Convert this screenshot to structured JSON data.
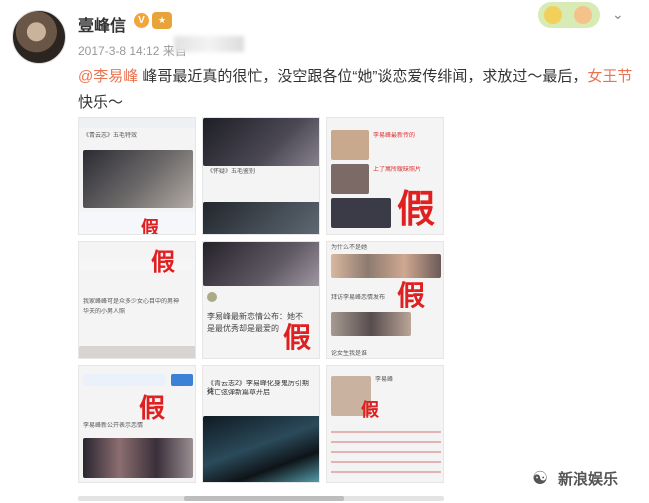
{
  "author": {
    "name": "壹峰信",
    "verified_mark": "V",
    "timestamp": "2017-3-8 14:12 来自"
  },
  "post": {
    "mention": "@李易峰",
    "text_before_tag": " 峰哥最近真的很忙，没空跟各位“她”谈恋爱传绯闻，求放过～最后，",
    "tag": "女王节",
    "text_after_tag": "快乐～"
  },
  "images": [
    {
      "label": "假",
      "lines": [
        "《青云志》五毛特效"
      ]
    },
    {
      "label": "",
      "lines": [
        "《怀疑》五毛鉴别",
        "李易峰实力再现"
      ]
    },
    {
      "label": "假",
      "lines": [
        "李易峰最新传的",
        "上了寓所暧昧照片",
        "李易峰传绯闻",
        "新秋兰大桥在一起"
      ]
    },
    {
      "label": "假",
      "lines": [
        "我家峰峰可是众多少女心目中的男神",
        "华夫的小男人照"
      ]
    },
    {
      "label": "假",
      "lines": [
        "李易峰最新恋情公布：她不",
        "是最优秀却是最爱的"
      ]
    },
    {
      "label": "假",
      "lines": [
        "为什么不是她",
        "拜访李易峰恋情发布",
        "论女生我是谁"
      ]
    },
    {
      "label": "假",
      "lines": [
        "李易峰新公开表示恋情"
      ]
    },
    {
      "label": "",
      "lines": [
        "《青云志2》李易峰化身鬼厉引期待",
        "死亡弦弹新篇章开启"
      ]
    },
    {
      "label": "假",
      "lines": [
        "李易峰"
      ]
    }
  ],
  "source_logo": "新浪娱乐",
  "icons": [
    "verified-icon",
    "member-medal-icon",
    "chevron-down-icon",
    "weibo-logo-icon"
  ],
  "colors": {
    "accent": "#eb7350",
    "fake_label": "#e02020"
  }
}
